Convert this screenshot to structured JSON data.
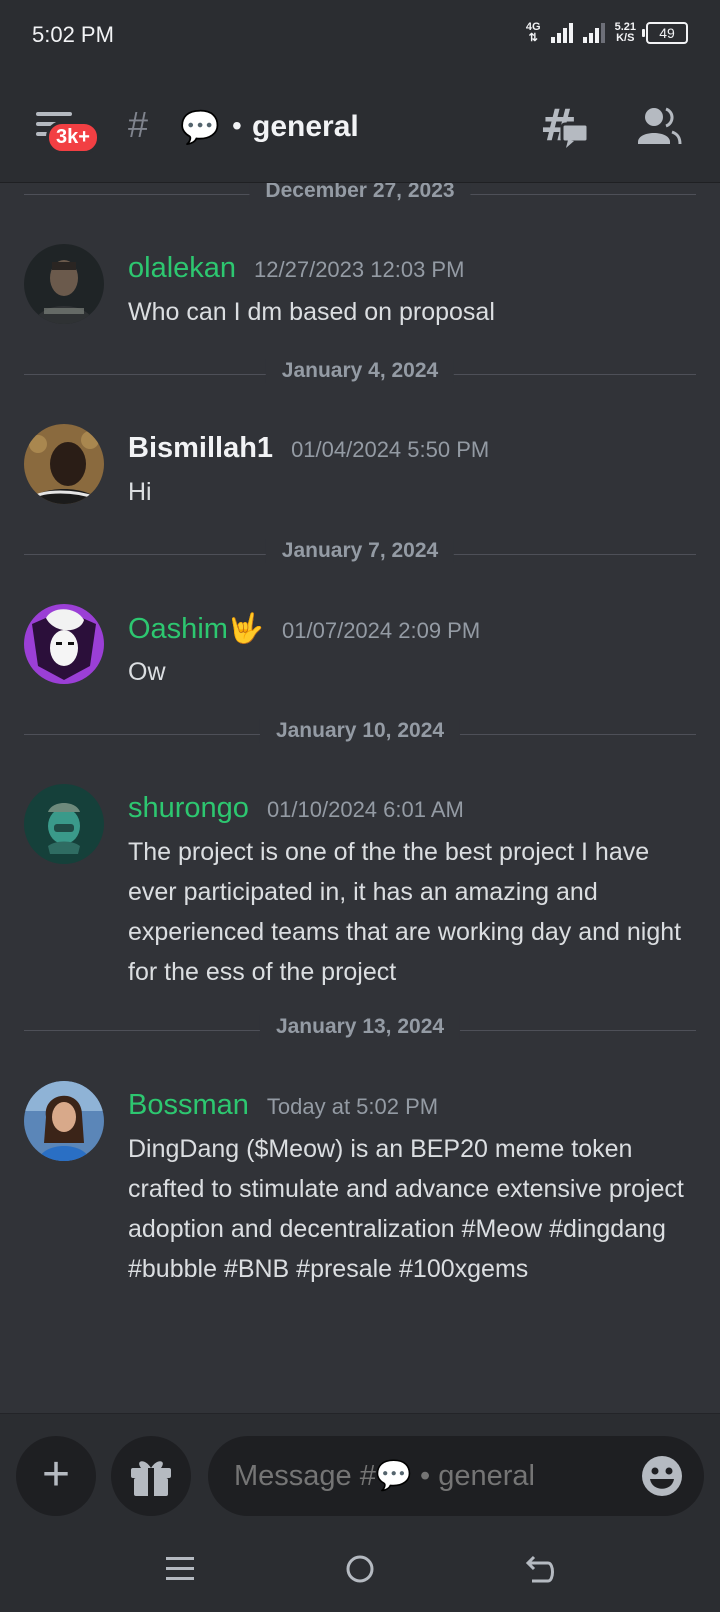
{
  "status_bar": {
    "time": "5:02 PM",
    "network": "4G",
    "speed_value": "5.21",
    "speed_unit": "K/S",
    "battery": "49"
  },
  "header": {
    "badge": "3k+",
    "channel_emoji": "💬",
    "channel_separator": "•",
    "channel_name": "general",
    "icons": [
      "menu-icon",
      "hash-icon",
      "threads-icon",
      "members-icon"
    ]
  },
  "messages": [
    {
      "date": "December 27, 2023",
      "author": "olalekan",
      "timestamp": "12/27/2023 12:03 PM",
      "text": "Who can I dm based on proposal",
      "author_color": "#2dc770"
    },
    {
      "date": "January 4, 2024",
      "author": "Bismillah1",
      "timestamp": "01/04/2024 5:50 PM",
      "text": "Hi",
      "author_color": "#f2f3f5"
    },
    {
      "date": "January 7, 2024",
      "author": "Oashim🤟",
      "timestamp": "01/07/2024 2:09 PM",
      "text": "Ow",
      "author_color": "#2dc770"
    },
    {
      "date": "January 10, 2024",
      "author": "shurongo",
      "timestamp": "01/10/2024 6:01 AM",
      "text": "The project is one of the the best project I have ever participated in, it has an amazing and experienced teams that are working day and night for the ess of the project",
      "author_color": "#2dc770"
    },
    {
      "date": "January 13, 2024",
      "author": "Bossman",
      "timestamp": "Today at 5:02 PM",
      "text": "DingDang ($Meow) is an BEP20 meme token crafted to stimulate and advance extensive project adoption and decentralization #Meow #dingdang #bubble #BNB   #presale #100xgems",
      "author_color": "#2dc770"
    }
  ],
  "composer": {
    "placeholder": "Message #💬 • general",
    "icons": [
      "plus-icon",
      "gift-icon",
      "emoji-icon"
    ]
  },
  "nav_bar": {
    "icons": [
      "recents-icon",
      "home-icon",
      "back-icon"
    ]
  },
  "colors": {
    "background": "#313338",
    "header": "#2b2d31",
    "input": "#1e1f22",
    "author_green": "#2dc770",
    "badge_red": "#f23f43",
    "muted": "#949ba4"
  }
}
